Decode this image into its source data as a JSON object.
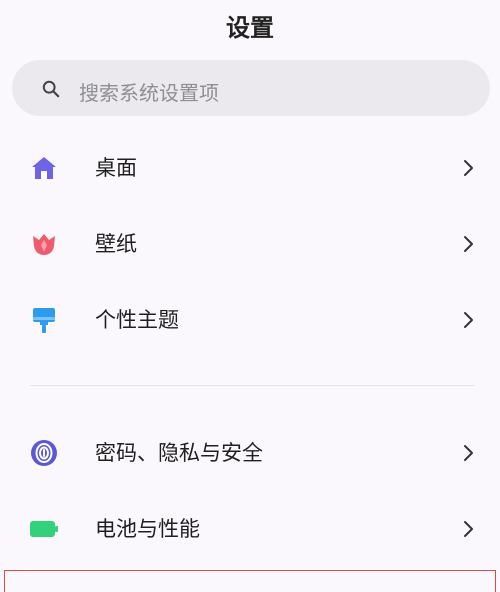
{
  "header": {
    "title": "设置"
  },
  "search": {
    "placeholder": "搜索系统设置项",
    "icon": "search-icon"
  },
  "groups": [
    {
      "items": [
        {
          "label": "桌面",
          "icon": "home-icon",
          "color": "#6f63e6"
        },
        {
          "label": "壁纸",
          "icon": "tulip-icon",
          "color": "#ef5b6e"
        },
        {
          "label": "个性主题",
          "icon": "paint-brush-icon",
          "color": "#2f9bf0"
        }
      ]
    },
    {
      "items": [
        {
          "label": "密码、隐私与安全",
          "icon": "fingerprint-icon",
          "color": "#5b58d6"
        },
        {
          "label": "电池与性能",
          "icon": "battery-icon",
          "color": "#33d17a"
        }
      ]
    }
  ],
  "colors": {
    "background": "#fbf8fd",
    "search_bg": "#ebe9ee",
    "highlight_border": "#e24a4a"
  }
}
